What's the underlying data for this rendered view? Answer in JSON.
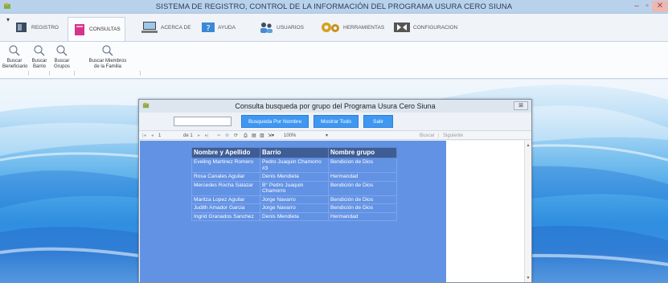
{
  "window": {
    "title": "SISTEMA DE REGISTRO, CONTROL DE LA INFORMACIÓN DEL PROGRAMA USURA CERO SIUNA"
  },
  "menu": {
    "items": [
      {
        "label": "REGISTRO",
        "icon": "registro-icon"
      },
      {
        "label": "CONSULTAS",
        "icon": "consultas-icon"
      },
      {
        "label": "ACERCA DE",
        "icon": "acerca-de-icon"
      },
      {
        "label": "AYUDA",
        "icon": "ayuda-icon"
      },
      {
        "label": "USUARIOS",
        "icon": "usuarios-icon"
      },
      {
        "label": "HERRAMIENTAS",
        "icon": "herramientas-icon"
      },
      {
        "label": "CONFIGURACION",
        "icon": "configuracion-icon"
      }
    ]
  },
  "ribbon": {
    "buttons": [
      {
        "line1": "Buscar",
        "line2": "Beneficiario"
      },
      {
        "line1": "Buscar",
        "line2": "Barrio"
      },
      {
        "line1": "Buscar",
        "line2": "Grupos"
      },
      {
        "line1": "Buscar Miembros",
        "line2": "de la Familia"
      }
    ]
  },
  "dialog": {
    "title": "Consulta busqueda por grupo del Programa Usura Cero Siuna",
    "close_label": "⊠",
    "search_value": "",
    "buttons": {
      "by_name": "Busqueda Por Nombre",
      "show_all": "Mostrar Todo",
      "exit": "Salir"
    },
    "report_toolbar": {
      "page_current": "1",
      "page_of": "de 1",
      "zoom": "100%",
      "find": "Buscar",
      "next": "Siguiente"
    },
    "table": {
      "headers": [
        "Nombre y Apellido",
        "Barrio",
        "Nombre grupo"
      ],
      "rows": [
        [
          "Eveling Martinez Romero",
          "Pedro Juaquin Chamorro #3",
          "Bendicion de Dios"
        ],
        [
          "Rosa Canales Aguilar",
          "Denis Mendieta",
          "Hermandad"
        ],
        [
          "Mercedes Rocha Salazar",
          "B° Pedro Juaquin Chamorro",
          "Bendición de Dios"
        ],
        [
          "Maritza Lopez Aguilar",
          "Jorge Navarro",
          "Bendición de Dios"
        ],
        [
          "Judith Amador Garcia",
          "Jorge Navarro",
          "Bendición de Dios"
        ],
        [
          "Ingrid Granados Sanchez",
          "Denis Mendieta",
          "Hermandad"
        ]
      ]
    }
  }
}
